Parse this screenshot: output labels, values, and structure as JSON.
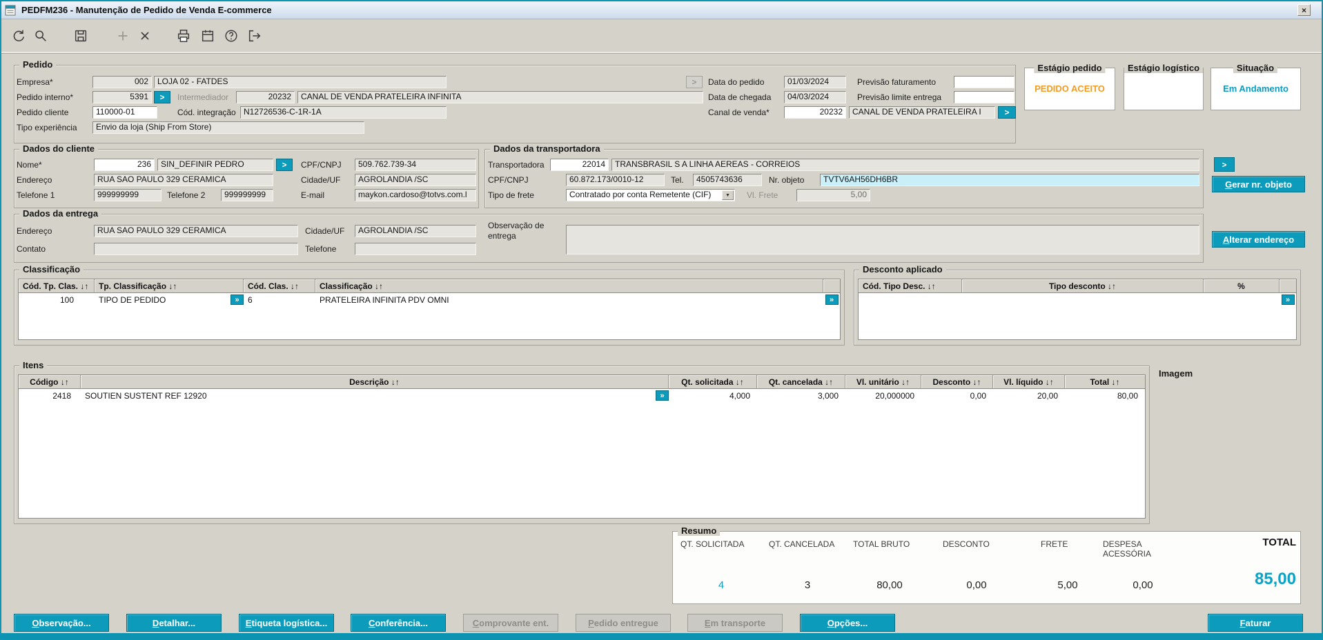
{
  "window": {
    "title": "PEDFM236 - Manutenção de Pedido de Venda E-commerce",
    "close_glyph": "×"
  },
  "ui": {
    "lookup_glyph": ">",
    "detail_glyph": "»",
    "dropdown_glyph": "▼"
  },
  "toolbar": {
    "icons": [
      "refresh",
      "search",
      "save",
      "add",
      "delete",
      "print",
      "calendar",
      "help",
      "exit"
    ]
  },
  "pedido": {
    "legend": "Pedido",
    "empresa": {
      "label": "Empresa*",
      "code": "002",
      "name": "LOJA 02 - FATDES"
    },
    "pedido_interno": {
      "label": "Pedido interno*",
      "value": "5391"
    },
    "intermediador": {
      "label": "Intermediador",
      "code": "20232",
      "name": "CANAL DE VENDA PRATELEIRA INFINITA"
    },
    "pedido_cliente": {
      "label": "Pedido cliente",
      "value": "110000-01"
    },
    "cod_integracao": {
      "label": "Cód. integração",
      "value": "N12726536-C-1R-1A"
    },
    "tipo_experiencia": {
      "label": "Tipo experiência",
      "value": "Envio da loja (Ship From Store)"
    },
    "data_pedido": {
      "label": "Data do pedido",
      "value": "01/03/2024"
    },
    "previsao_faturamento": {
      "label": "Previsão faturamento",
      "value": ""
    },
    "data_chegada": {
      "label": "Data de chegada",
      "value": "04/03/2024"
    },
    "previsao_limite": {
      "label": "Previsão limite entrega",
      "value": ""
    },
    "canal_venda": {
      "label": "Canal de venda*",
      "code": "20232",
      "name": "CANAL DE VENDA PRATELEIRA I"
    }
  },
  "status": {
    "estagio_pedido": {
      "label": "Estágio pedido",
      "value": "PEDIDO ACEITO"
    },
    "estagio_logistico": {
      "label": "Estágio logístico",
      "value": ""
    },
    "situacao": {
      "label": "Situação",
      "value": "Em Andamento"
    }
  },
  "cliente": {
    "legend": "Dados do cliente",
    "nome": {
      "label": "Nome*",
      "code": "236",
      "name": "SIN_DEFINIR PEDRO"
    },
    "cpf": {
      "label": "CPF/CNPJ",
      "value": "509.762.739-34"
    },
    "endereco": {
      "label": "Endereço",
      "value": "RUA SAO PAULO 329 CERAMICA"
    },
    "cidade": {
      "label": "Cidade/UF",
      "value": "AGROLANDIA /SC"
    },
    "telefone1": {
      "label": "Telefone 1",
      "value": "999999999"
    },
    "telefone2": {
      "label": "Telefone 2",
      "value": "999999999"
    },
    "email": {
      "label": "E-mail",
      "value": "maykon.cardoso@totvs.com.l"
    }
  },
  "transportadora": {
    "legend": "Dados da transportadora",
    "transportadora": {
      "label": "Transportadora",
      "code": "22014",
      "name": "TRANSBRASIL S A LINHA AEREAS - CORREIOS"
    },
    "cpf": {
      "label": "CPF/CNPJ",
      "value": "60.872.173/0010-12"
    },
    "tel": {
      "label": "Tel.",
      "value": "4505743636"
    },
    "nr_objeto": {
      "label": "Nr. objeto",
      "value": "TVTV6AH56DH6BR"
    },
    "tipo_frete": {
      "label": "Tipo de frete",
      "value": "Contratado por conta Remetente (CIF)"
    },
    "vl_frete": {
      "label": "Vl. Frete",
      "value": "5,00"
    },
    "gerar_btn": "Gerar nr. objeto"
  },
  "entrega": {
    "legend": "Dados da entrega",
    "endereco": {
      "label": "Endereço",
      "value": "RUA SAO PAULO 329 CERAMICA"
    },
    "cidade": {
      "label": "Cidade/UF",
      "value": "AGROLANDIA /SC"
    },
    "observacao": {
      "label": "Observação de entrega",
      "value": ""
    },
    "contato": {
      "label": "Contato",
      "value": ""
    },
    "telefone": {
      "label": "Telefone",
      "value": ""
    },
    "alterar_btn": "Alterar endereço"
  },
  "classificacao": {
    "legend": "Classificação",
    "headers": [
      "Cód. Tp. Clas. ↓↑",
      "Tp. Classificação ↓↑",
      "Cód. Clas. ↓↑",
      "Classificação ↓↑"
    ],
    "rows": [
      {
        "cod_tp": "100",
        "tp": "TIPO DE PEDIDO",
        "cod": "6",
        "nome": "PRATELEIRA INFINITA PDV OMNI"
      }
    ]
  },
  "desconto": {
    "legend": "Desconto aplicado",
    "headers": [
      "Cód. Tipo Desc. ↓↑",
      "Tipo desconto ↓↑",
      "%"
    ]
  },
  "itens": {
    "legend": "Itens",
    "imagem_label": "Imagem",
    "headers": [
      "Código ↓↑",
      "Descrição ↓↑",
      "Qt. solicitada ↓↑",
      "Qt. cancelada ↓↑",
      "Vl. unitário ↓↑",
      "Desconto ↓↑",
      "Vl. líquido ↓↑",
      "Total ↓↑"
    ],
    "rows": [
      {
        "codigo": "2418",
        "descricao": "SOUTIEN SUSTENT REF 12920",
        "qt_solicitada": "4,000",
        "qt_cancelada": "3,000",
        "vl_unitario": "20,000000",
        "desconto": "0,00",
        "vl_liquido": "20,00",
        "total": "80,00"
      }
    ]
  },
  "resumo": {
    "legend": "Resumo",
    "cols": [
      {
        "label": "QT. SOLICITADA",
        "value": "4"
      },
      {
        "label": "QT. CANCELADA",
        "value": "3"
      },
      {
        "label": "TOTAL BRUTO",
        "value": "80,00"
      },
      {
        "label": "DESCONTO",
        "value": "0,00"
      },
      {
        "label": "FRETE",
        "value": "5,00"
      },
      {
        "label": "DESPESA ACESSÓRIA",
        "value": "0,00"
      },
      {
        "label": "TOTAL",
        "value": "85,00"
      }
    ]
  },
  "actions": {
    "observacao": "Observação...",
    "detalhar": "Detalhar...",
    "etiqueta": "Etiqueta logística...",
    "conferencia": "Conferência...",
    "comprovante": "Comprovante ent.",
    "pedido_entregue": "Pedido entregue",
    "em_transporte": "Em transporte",
    "opcoes": "Opções...",
    "faturar": "Faturar"
  },
  "colors": {
    "teal": "#0d9bbb",
    "orange": "#f59c20",
    "highlight": "#c9eff8"
  }
}
